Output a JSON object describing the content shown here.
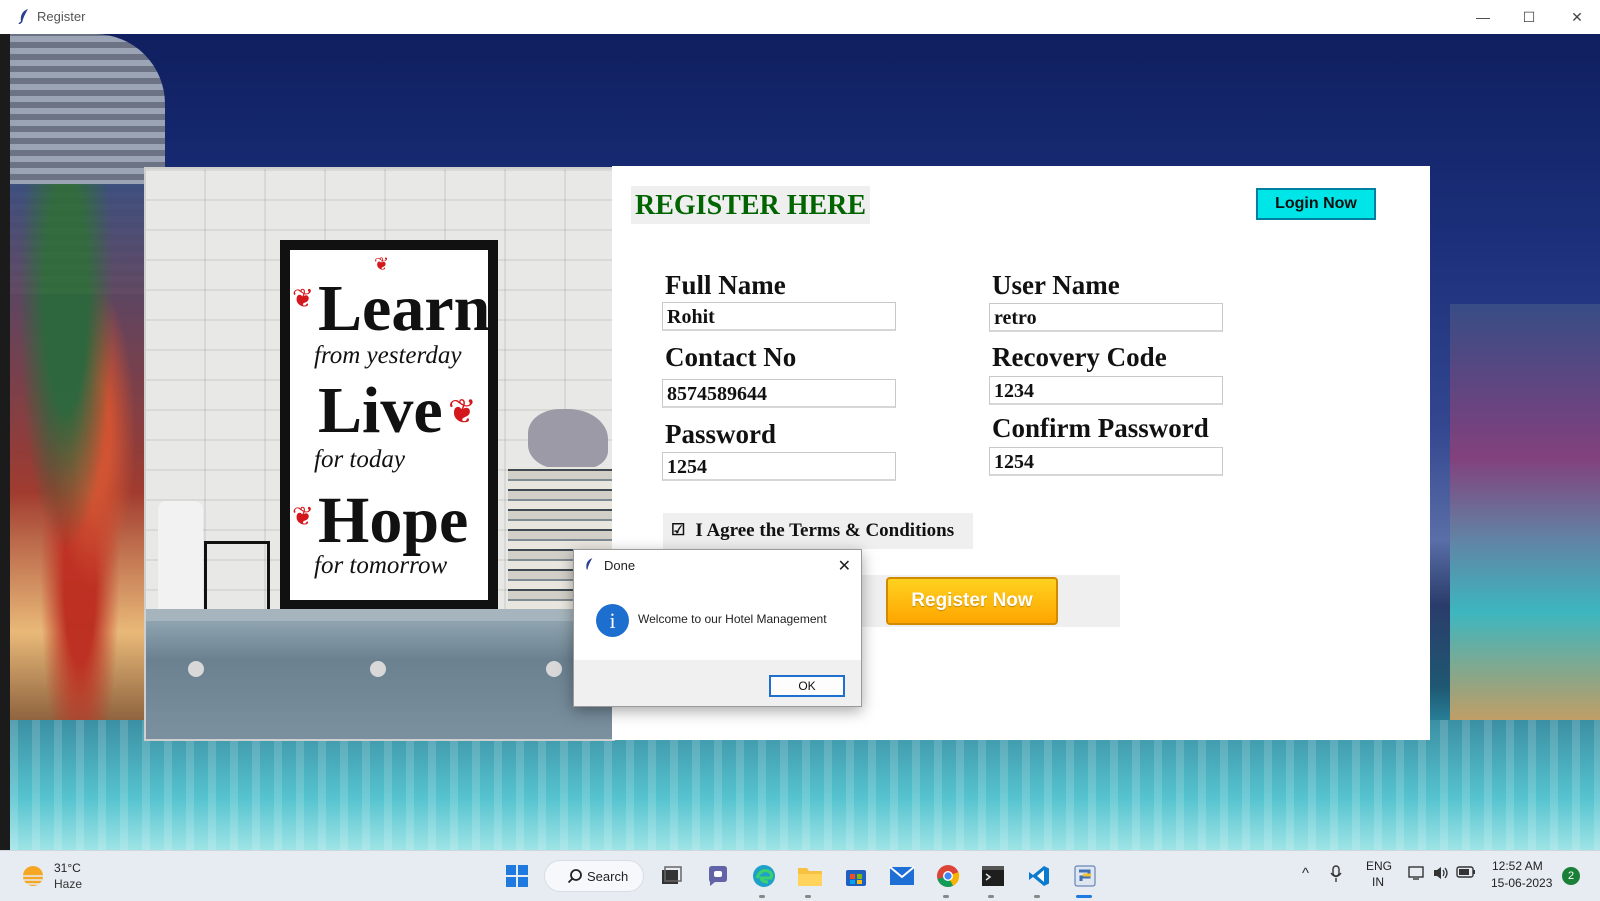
{
  "window": {
    "title": "Register",
    "controls": {
      "minimize": "—",
      "maximize": "☐",
      "close": "✕"
    }
  },
  "poster": {
    "line1": "Learn",
    "line2": "from yesterday",
    "line3": "Live",
    "line4": "for today",
    "line5": "Hope",
    "line6": "for tomorrow"
  },
  "form": {
    "heading": "REGISTER HERE",
    "login_button": "Login Now",
    "fields": {
      "full_name": {
        "label": "Full Name",
        "value": "Rohit"
      },
      "user_name": {
        "label": "User Name",
        "value": "retro"
      },
      "contact_no": {
        "label": "Contact No",
        "value": "8574589644"
      },
      "recovery_code": {
        "label": "Recovery Code",
        "value": "1234"
      },
      "password": {
        "label": "Password",
        "value": "1254"
      },
      "confirm_password": {
        "label": "Confirm Password",
        "value": "1254"
      }
    },
    "terms_checkbox": {
      "checked": true,
      "mark": "☑",
      "label": "I Agree the Terms & Conditions"
    },
    "register_button": "Register Now"
  },
  "dialog": {
    "title": "Done",
    "message": "Welcome to our Hotel Management",
    "ok_button": "OK",
    "close_glyph": "✕",
    "icon_glyph": "i"
  },
  "taskbar": {
    "weather": {
      "temp": "31°C",
      "condition": "Haze"
    },
    "search_label": "Search",
    "apps": [
      "start-icon",
      "task-view-icon",
      "teams-chat-icon",
      "edge-icon",
      "file-explorer-icon",
      "store-icon",
      "mail-icon",
      "chrome-icon",
      "terminal-icon",
      "vscode-icon",
      "python-app-icon"
    ],
    "tray": {
      "chevron": "^",
      "lang_line1": "ENG",
      "lang_line2": "IN",
      "time": "12:52 AM",
      "date": "15-06-2023",
      "notification_count": "2"
    }
  },
  "colors": {
    "heading_green": "#006400",
    "login_cyan": "#00e5e8",
    "register_orange": "#ffa500",
    "info_blue": "#1c6fcf"
  }
}
